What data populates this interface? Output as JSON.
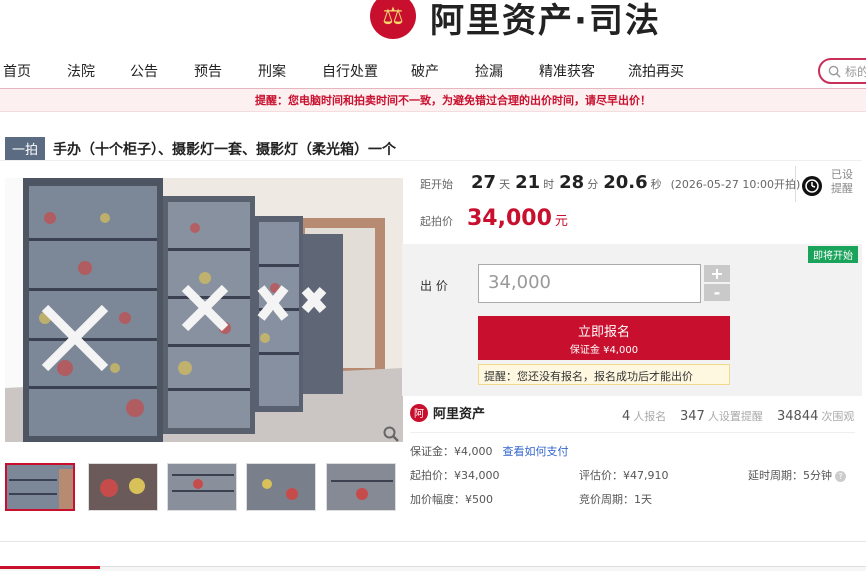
{
  "logo": {
    "text": "阿里资产·司法",
    "emblem_icon": "court-emblem-icon"
  },
  "nav": {
    "items": [
      "首页",
      "法院",
      "公告",
      "预告",
      "刑案",
      "自行处置",
      "破产",
      "捡漏",
      "精准获客",
      "流拍再买"
    ]
  },
  "search": {
    "placeholder": "标的"
  },
  "notice": {
    "text": "提醒：您电脑时间和拍卖时间不一致，为避免错过合理的出价时间，请尽早出价！"
  },
  "item": {
    "badge": "一拍",
    "title": "手办（十个柜子）、摄影灯一套、摄影灯（柔光箱）一个"
  },
  "countdown": {
    "label": "距开始",
    "days": "27",
    "days_unit": "天",
    "hours": "21",
    "hours_unit": "时",
    "minutes": "28",
    "minutes_unit": "分",
    "seconds": "20.6",
    "seconds_unit": "秒",
    "start_time": "(2026-05-27 10:00开拍)"
  },
  "reminder": {
    "text": "已设提醒"
  },
  "start_price": {
    "label": "起拍价",
    "value": "34,000",
    "unit": "元"
  },
  "bid": {
    "status_tag": "即将开始",
    "label": "出 价",
    "input_value": "34,000",
    "plus": "+",
    "minus": "-",
    "apply_label": "立即报名",
    "deposit_label": "保证金 ¥4,000",
    "tip": "提醒：您还没有报名，报名成功后才能出价"
  },
  "stats": {
    "brand": "阿里资产",
    "signups": "4",
    "signups_label": "人报名",
    "reminders": "347",
    "reminders_label": "人设置提醒",
    "views": "34844",
    "views_label": "次围观"
  },
  "details": {
    "deposit": "保证金：¥4,000",
    "payment_link": "查看如何支付",
    "start_price": "起拍价：¥34,000",
    "appraisal": "评估价：¥47,910",
    "delay": "延时周期：5分钟",
    "increment": "加价幅度：¥500",
    "bid_period": "竞价周期：1天"
  },
  "colors": {
    "accent": "#c8102e",
    "green": "#1aa35a",
    "link": "#3366cc"
  }
}
